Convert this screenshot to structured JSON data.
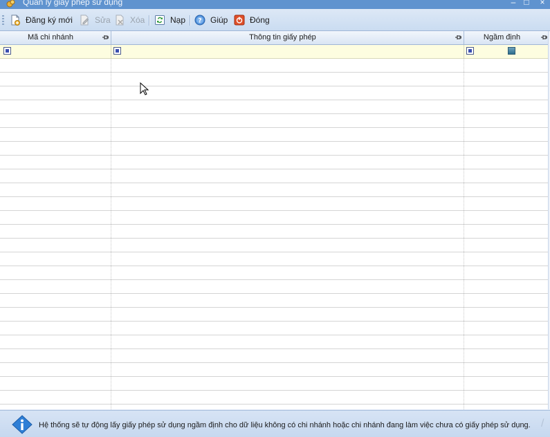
{
  "window": {
    "title": "Quản lý giấy phép sử dụng",
    "minimize_glyph": "–",
    "maximize_glyph": "□",
    "close_glyph": "×"
  },
  "toolbar": {
    "register_label": "Đăng ký mới",
    "edit_label": "Sửa",
    "delete_label": "Xóa",
    "reload_label": "Nạp",
    "help_label": "Giúp",
    "close_label": "Đóng"
  },
  "grid": {
    "columns": [
      {
        "label": "Mã chi nhánh"
      },
      {
        "label": "Thông tin giấy phép"
      },
      {
        "label": "Ngầm định"
      }
    ],
    "rows": []
  },
  "status": {
    "message": "Hệ thống sẽ tự động lấy giấy phép sử dụng ngầm định cho dữ liệu không có chi nhánh hoặc chi nhánh đang làm việc chưa có giấy phép sử dụng."
  },
  "colors": {
    "titlebar": "#5f93cf",
    "toolbar": "#d3e1f3",
    "filter_row": "#fdfde0",
    "grid_line": "#d4d4d4"
  },
  "icons": [
    "app-icon",
    "new-document-icon",
    "edit-document-icon",
    "delete-document-icon",
    "reload-icon",
    "help-icon",
    "close-icon",
    "pin-icon",
    "info-icon"
  ]
}
